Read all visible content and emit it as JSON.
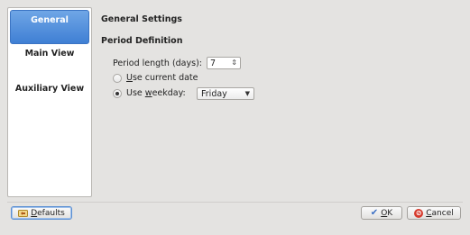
{
  "sidebar": {
    "items": [
      {
        "label": "General",
        "active": true
      },
      {
        "label": "Main View",
        "active": false
      },
      {
        "label": "Auxiliary View",
        "active": false
      }
    ]
  },
  "main": {
    "title": "General Settings",
    "section": "Period Definition",
    "period_label": "Period length (days):",
    "period_value": "7",
    "radio_current_accel": "U",
    "radio_current_rest": "se current date",
    "radio_current_selected": false,
    "radio_weekday_pre": "Use ",
    "radio_weekday_accel": "w",
    "radio_weekday_rest": "eekday:",
    "radio_weekday_selected": true,
    "weekday_value": "Friday"
  },
  "buttons": {
    "defaults_accel": "D",
    "defaults_rest": "efaults",
    "ok_accel": "O",
    "ok_rest": "K",
    "cancel_accel": "C",
    "cancel_rest": "ancel"
  },
  "icons": {
    "defaults": "reset-icon",
    "ok": "checkmark-icon",
    "cancel": "cancel-icon"
  },
  "colors": {
    "accent": "#4a8ad9",
    "cancel_red": "#d63a2c"
  }
}
